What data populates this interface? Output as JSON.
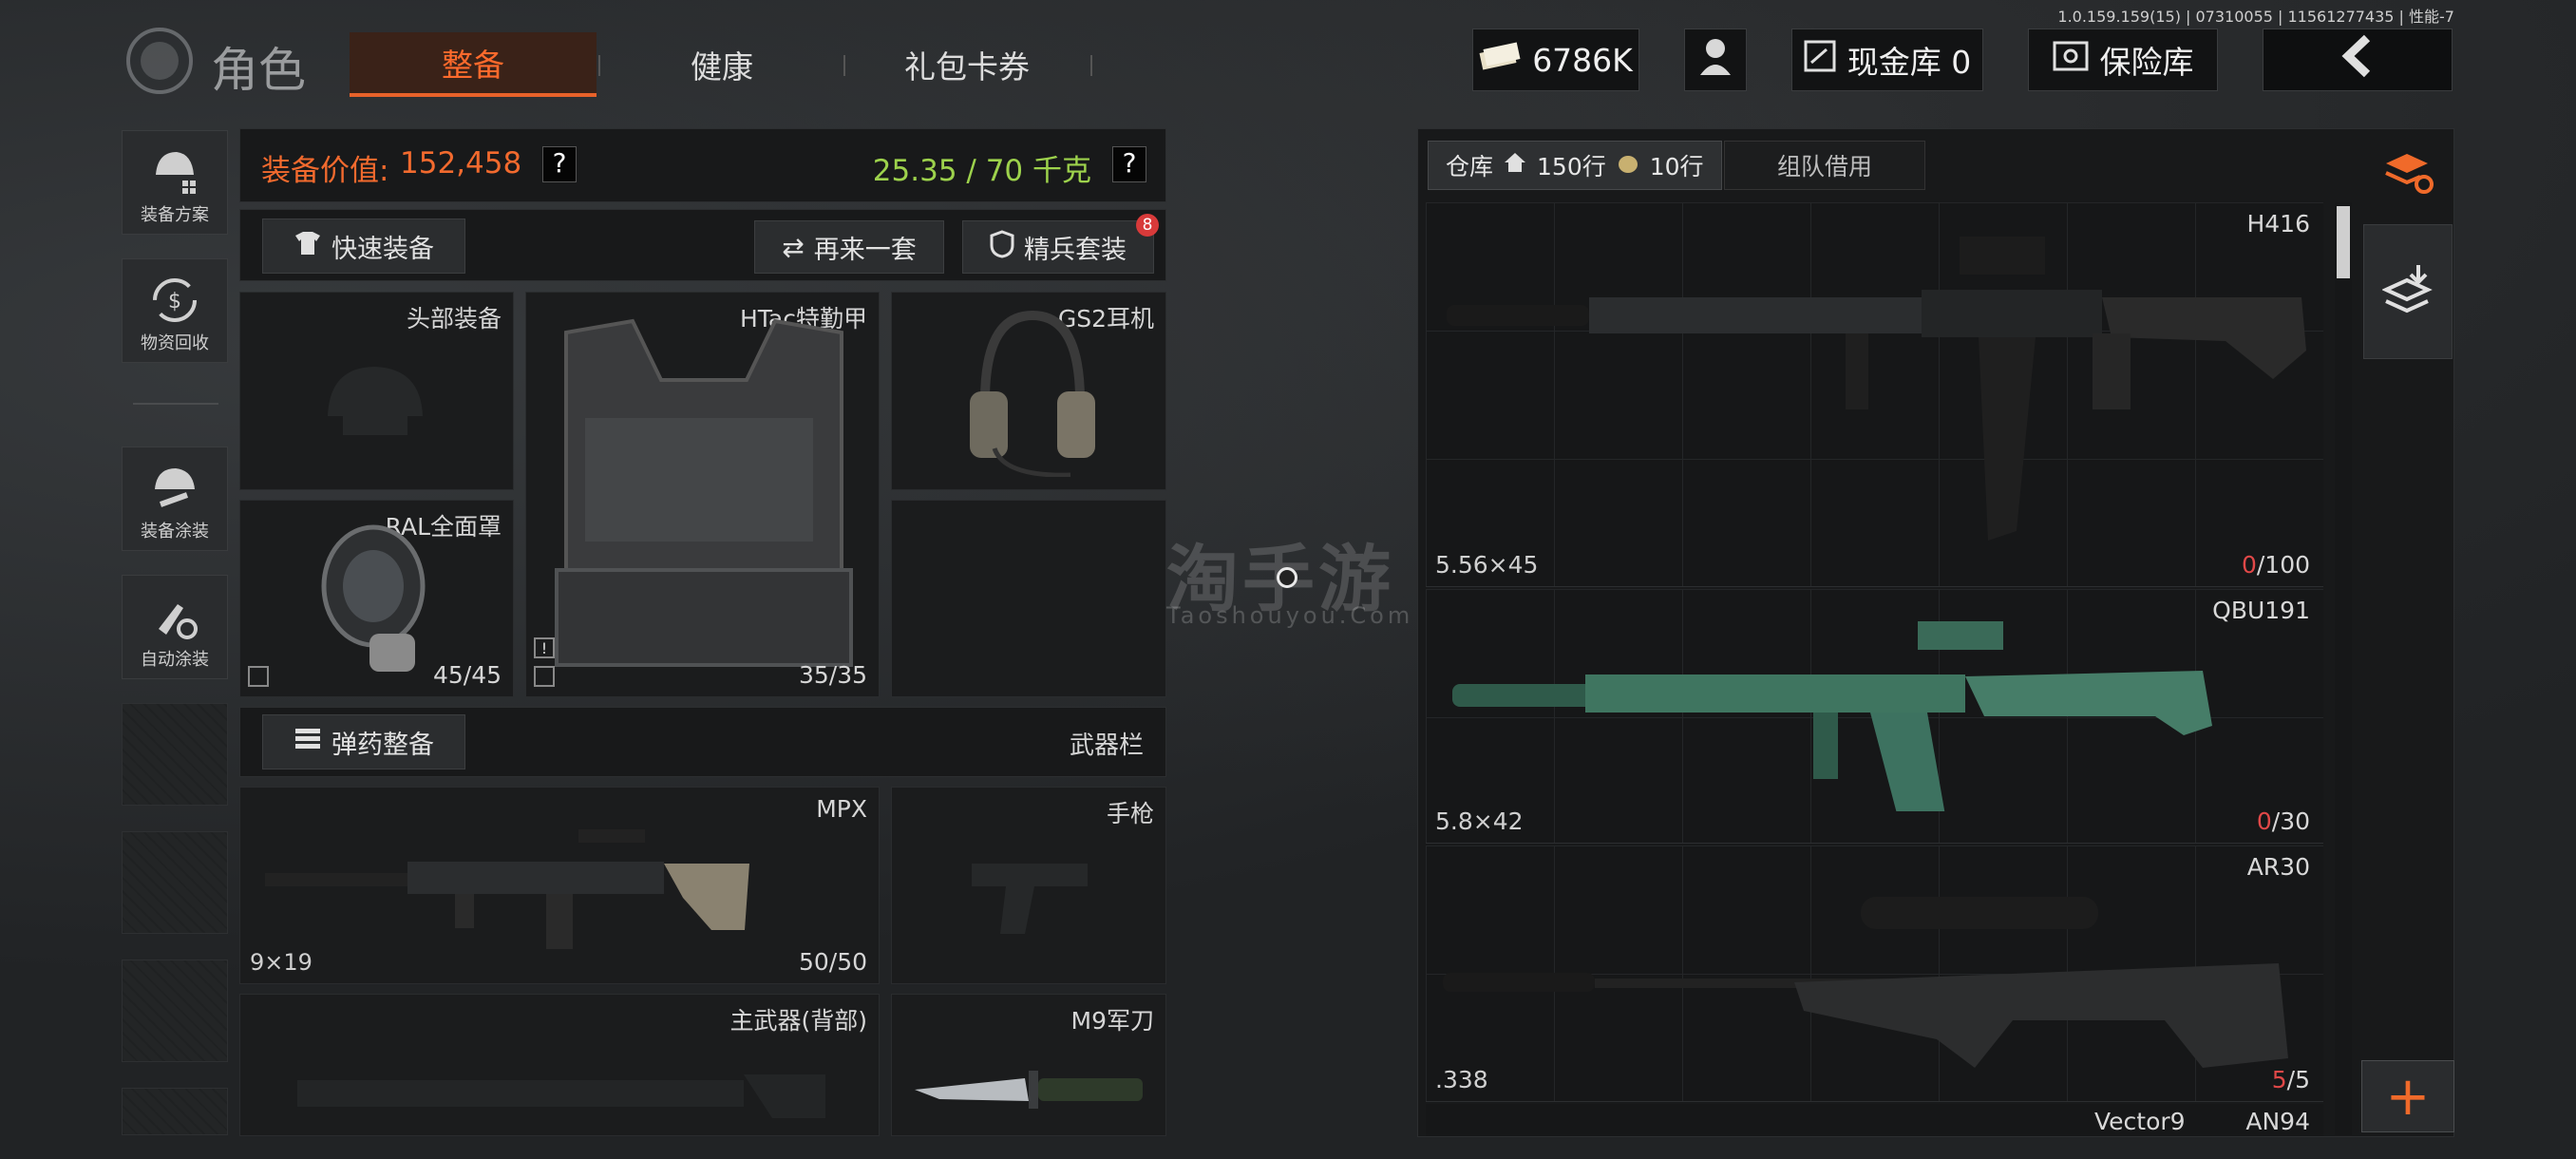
{
  "build": "1.0.159.159(15) | 07310055 | 11561277435 | 性能-7",
  "header": {
    "title": "角色",
    "tabs": [
      "整备",
      "健康",
      "礼包卡券"
    ],
    "money": "6786K",
    "cash_label": "现金库 0",
    "safe_label": "保险库"
  },
  "sidebar": [
    "装备方案",
    "物资回收",
    "装备涂装",
    "自动涂装"
  ],
  "stats": {
    "value_label": "装备价值:",
    "value": "152,458",
    "weight": "25.35 / 70 千克",
    "help": "?"
  },
  "actions": {
    "quick_equip": "快速装备",
    "again": "再来一套",
    "elite": "精兵套装",
    "elite_badge": "8"
  },
  "slots": {
    "head": {
      "label": "头部装备"
    },
    "armor": {
      "label": "HTac特勤甲",
      "count": "35/35"
    },
    "headset": {
      "label": "GS2耳机"
    },
    "mask": {
      "label": "RAL全面罩",
      "count": "45/45"
    }
  },
  "ammo": {
    "button": "弹药整备",
    "weapon_bar": "武器栏"
  },
  "weapons_equipped": {
    "primary": {
      "name": "MPX",
      "caliber": "9×19",
      "count": "50/50"
    },
    "pistol": {
      "label": "手枪"
    },
    "back": {
      "label": "主武器(背部)"
    },
    "knife": {
      "label": "M9军刀"
    }
  },
  "warehouse": {
    "tab_label": "仓库",
    "rows_home": "150行",
    "rows_extra": "10行",
    "team_tab": "组队借用",
    "items": [
      {
        "name": "H416",
        "caliber": "5.56×45",
        "count_current": "0",
        "count_total": "/100"
      },
      {
        "name": "QBU191",
        "caliber": "5.8×42",
        "count_current": "0",
        "count_total": "/30"
      },
      {
        "name": "AR30",
        "caliber": ".338",
        "count_current": "5",
        "count_total": "/5"
      }
    ],
    "partial": [
      "Vector9",
      "AN94"
    ]
  },
  "watermark": {
    "cn": "淘手游",
    "en": "Taoshouyou.Com"
  },
  "plus": "+"
}
